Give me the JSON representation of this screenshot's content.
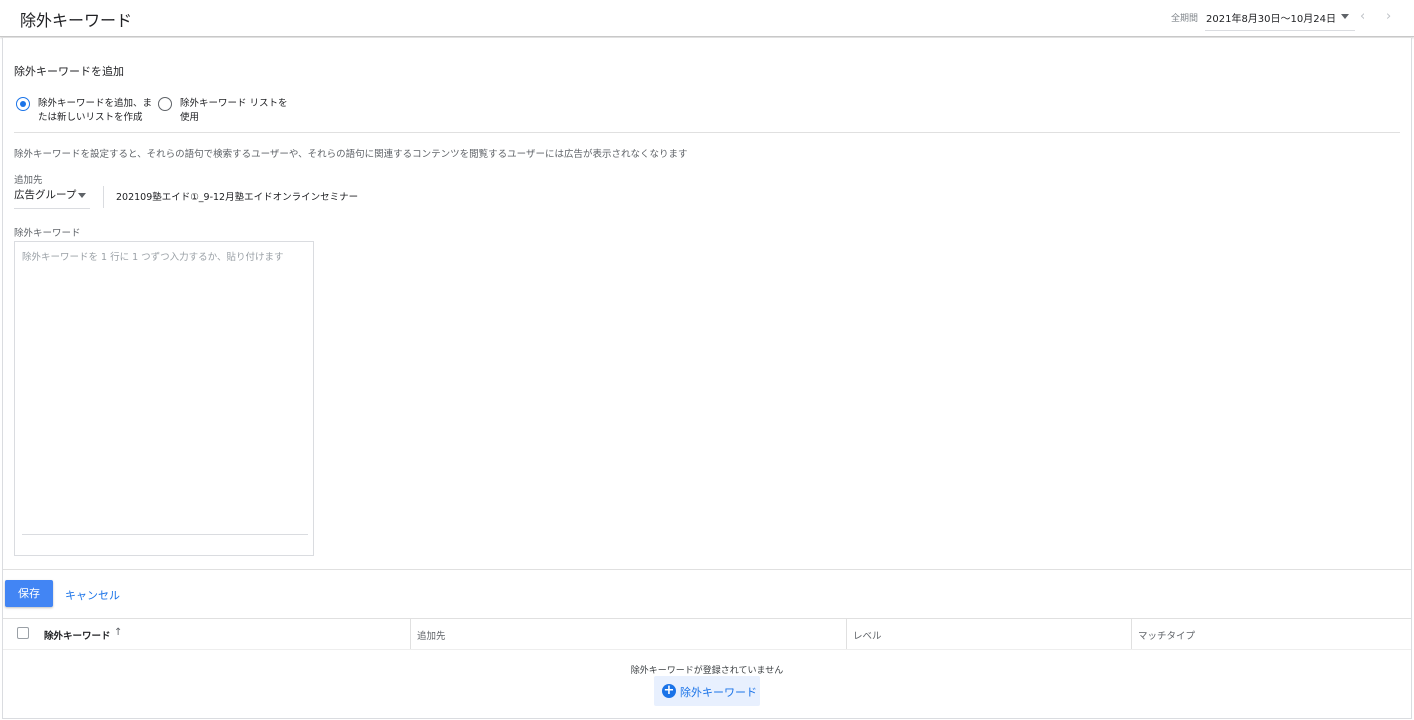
{
  "header": {
    "title": "除外キーワード",
    "period_label": "全期間",
    "period_value": "2021年8月30日～10月24日",
    "prev_icon": "‹",
    "next_icon": "›"
  },
  "form": {
    "section_title": "除外キーワードを追加",
    "radio_add": {
      "line1": "除外キーワードを追加、ま",
      "line2": "たは新しいリストを作成",
      "checked": true
    },
    "radio_list": {
      "line1": "除外キーワード リストを",
      "line2": "使用",
      "checked": false
    },
    "info_text": "除外キーワードを設定すると、それらの語句で検索するユーザーや、それらの語句に関連するコンテンツを閲覧するユーザーには広告が表示されなくなります",
    "target_label": "追加先",
    "target_type": "広告グループ",
    "adgroup_name": "202109塾エイド①_9-12月塾エイドオンラインセミナー",
    "keywords_label": "除外キーワード",
    "keywords_placeholder": "除外キーワードを 1 行に 1 つずつ入力するか、貼り付けます",
    "keywords_value": ""
  },
  "actions": {
    "save_label": "保存",
    "cancel_label": "キャンセル"
  },
  "table": {
    "columns": [
      "除外キーワード",
      "追加先",
      "レベル",
      "マッチタイプ"
    ],
    "sort_icon": "↑",
    "rows": [],
    "empty_message": "除外キーワードが登録されていません",
    "add_button_label": "除外キーワード",
    "add_button_icon": "+"
  },
  "colors": {
    "accent": "#1a73e8",
    "primary_button": "#4285f4",
    "add_button_bg": "#e8f0fe"
  }
}
